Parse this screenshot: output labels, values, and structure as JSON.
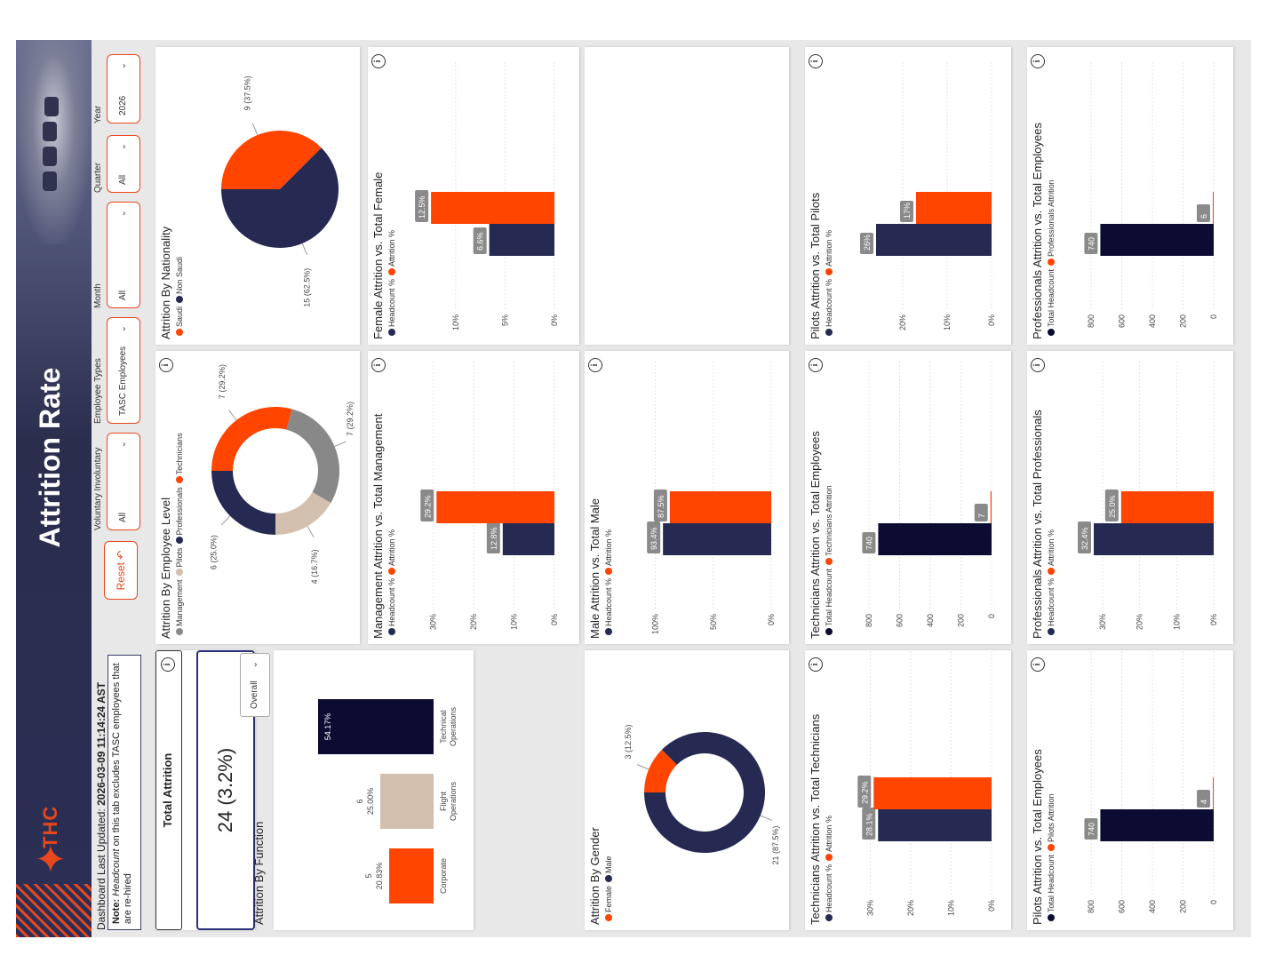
{
  "header": {
    "logo_text": "THC",
    "title": "Attrition Rate"
  },
  "updated": {
    "label": "Dashboard Last Updated: ",
    "value": "2026-03-09 11:14:24 AST"
  },
  "note": {
    "bold": "Note:",
    "italic": "Headcount",
    "text": " on this tab excludes TASC employees that are re-hired"
  },
  "filters": {
    "reset_label": "Reset",
    "items": [
      {
        "label": "Voluntary Involuntary",
        "value": "All"
      },
      {
        "label": "Employee Types",
        "value": "TASC Employees"
      },
      {
        "label": "Month",
        "value": "All"
      },
      {
        "label": "Quarter",
        "value": "All"
      },
      {
        "label": "Year",
        "value": "2026"
      }
    ]
  },
  "kpi": {
    "title": "Total Attrition",
    "value": "24 (3.2%)"
  },
  "function_select": {
    "value": "Overall"
  },
  "colors": {
    "navy": "#262a52",
    "dark": "#0c0c33",
    "orange": "#ff4500",
    "gray": "#888888",
    "beige": "#d3bfad",
    "label_bg": "#8a8a8a"
  },
  "charts": {
    "employee_level": {
      "title": "Attrition By Employee Level",
      "legend": [
        "Management",
        "Pilots",
        "Professionals",
        "Technicians"
      ],
      "chart_data": {
        "type": "pie",
        "donut": true,
        "categories": [
          "Technicians",
          "Management",
          "Pilots",
          "Professionals"
        ],
        "values": [
          7,
          7,
          4,
          6
        ],
        "labels": [
          "7 (29.2%)",
          "7 (29.2%)",
          "4 (16.7%)",
          "6 (25.0%)"
        ]
      }
    },
    "nationality": {
      "title": "Attrition By Nationality",
      "legend": [
        "Saudi",
        "Non Saudi"
      ],
      "chart_data": {
        "type": "pie",
        "categories": [
          "Saudi",
          "Non Saudi"
        ],
        "values": [
          9,
          15
        ],
        "labels": [
          "9 (37.5%)",
          "15 (62.5%)"
        ]
      }
    },
    "function": {
      "title": "Attrition By Function",
      "chart_data": {
        "type": "bar",
        "categories": [
          "Corporate",
          "Flight Operations",
          "Technical Operations"
        ],
        "values": [
          20.83,
          25.0,
          54.17
        ],
        "counts": [
          "5",
          "6",
          ""
        ],
        "labels": [
          "20.83%",
          "25.00%",
          "54.17%"
        ]
      }
    },
    "gender": {
      "title": "Attrition By Gender",
      "legend": [
        "Female",
        "Male"
      ],
      "chart_data": {
        "type": "pie",
        "donut": true,
        "categories": [
          "Female",
          "Male"
        ],
        "values": [
          3,
          21
        ],
        "labels": [
          "3 (12.5%)",
          "21 (87.5%)"
        ]
      }
    },
    "mgmt": {
      "title": "Management Attrition vs. Total Management",
      "legend": [
        "Headcount %",
        "Attrition %"
      ],
      "chart_data": {
        "type": "bar",
        "series": [
          {
            "name": "Headcount %",
            "values": [
              12.8
            ]
          },
          {
            "name": "Attrition %",
            "values": [
              29.2
            ]
          }
        ],
        "labels": [
          "12.8%",
          "29.2%"
        ],
        "yticks": [
          "0%",
          "10%",
          "20%",
          "30%"
        ],
        "ylim": [
          0,
          33
        ]
      }
    },
    "male": {
      "title": "Male Attrition vs. Total Male",
      "legend": [
        "Headcount %",
        "Attrition %"
      ],
      "chart_data": {
        "type": "bar",
        "series": [
          {
            "name": "Headcount %",
            "values": [
              93.4
            ]
          },
          {
            "name": "Attrition %",
            "values": [
              87.5
            ]
          }
        ],
        "labels": [
          "93.4%",
          "87.5%"
        ],
        "yticks": [
          "0%",
          "50%",
          "100%"
        ],
        "ylim": [
          0,
          115
        ]
      }
    },
    "female": {
      "title": "Female Attrition vs. Total Female",
      "legend": [
        "Headcount %",
        "Attrition %"
      ],
      "chart_data": {
        "type": "bar",
        "series": [
          {
            "name": "Headcount %",
            "values": [
              6.6
            ]
          },
          {
            "name": "Attrition %",
            "values": [
              12.5
            ]
          }
        ],
        "labels": [
          "6.6%",
          "12.5%"
        ],
        "yticks": [
          "0%",
          "5%",
          "10%"
        ],
        "ylim": [
          0,
          13.5
        ]
      }
    },
    "tech_pct": {
      "title": "Technicians Attrition vs. Total Technicians",
      "legend": [
        "Headcount %",
        "Attrition %"
      ],
      "chart_data": {
        "type": "bar",
        "series": [
          {
            "name": "Headcount %",
            "values": [
              28.1
            ]
          },
          {
            "name": "Attrition %",
            "values": [
              29.2
            ]
          }
        ],
        "labels": [
          "28.1%",
          "29.2%"
        ],
        "yticks": [
          "0%",
          "10%",
          "20%",
          "30%"
        ],
        "ylim": [
          0,
          33
        ]
      }
    },
    "tech_emp": {
      "title": "Technicians Attrition vs. Total Employees",
      "legend": [
        "Total Headcount",
        "Technicians Attrition"
      ],
      "chart_data": {
        "type": "bar",
        "series": [
          {
            "name": "Total Headcount",
            "values": [
              740
            ]
          },
          {
            "name": "Technicians Attrition",
            "values": [
              7
            ]
          }
        ],
        "labels": [
          "740",
          "7"
        ],
        "yticks": [
          "0",
          "200",
          "400",
          "600",
          "800"
        ],
        "ylim": [
          0,
          870
        ]
      }
    },
    "pilots_pct": {
      "title": "Pilots Attrition vs. Total Pilots",
      "legend": [
        "Headcount %",
        "Attrition %"
      ],
      "chart_data": {
        "type": "bar",
        "series": [
          {
            "name": "Headcount %",
            "values": [
              26
            ]
          },
          {
            "name": "Attrition %",
            "values": [
              17
            ]
          }
        ],
        "labels": [
          "26%",
          "17%"
        ],
        "yticks": [
          "0%",
          "10%",
          "20%"
        ],
        "ylim": [
          0,
          30
        ]
      }
    },
    "pilots_emp": {
      "title": "Pilots Attrition vs. Total Employees",
      "legend": [
        "Total Headcount",
        "Pilots Attrition"
      ],
      "chart_data": {
        "type": "bar",
        "series": [
          {
            "name": "Total Headcount",
            "values": [
              740
            ]
          },
          {
            "name": "Pilots Attrition",
            "values": [
              4
            ]
          }
        ],
        "labels": [
          "740",
          "4"
        ],
        "yticks": [
          "0",
          "200",
          "400",
          "600",
          "800"
        ],
        "ylim": [
          0,
          870
        ]
      }
    },
    "prof_pct": {
      "title": "Professionals Attrition vs. Total Professionals",
      "legend": [
        "Headcount %",
        "Attrition %"
      ],
      "chart_data": {
        "type": "bar",
        "series": [
          {
            "name": "Headcount %",
            "values": [
              32.4
            ]
          },
          {
            "name": "Attrition %",
            "values": [
              25.0
            ]
          }
        ],
        "labels": [
          "32.4%",
          "25.0%"
        ],
        "yticks": [
          "0%",
          "10%",
          "20%",
          "30%"
        ],
        "ylim": [
          0,
          36
        ]
      }
    },
    "prof_emp": {
      "title": "Professionals Attrition vs. Total Employees",
      "legend": [
        "Total Headcount",
        "Professionals Attrition"
      ],
      "chart_data": {
        "type": "bar",
        "series": [
          {
            "name": "Total Headcount",
            "values": [
              740
            ]
          },
          {
            "name": "Professionals Attrition",
            "values": [
              6
            ]
          }
        ],
        "labels": [
          "740",
          "6"
        ],
        "yticks": [
          "0",
          "200",
          "400",
          "600",
          "800"
        ],
        "ylim": [
          0,
          870
        ]
      }
    }
  }
}
